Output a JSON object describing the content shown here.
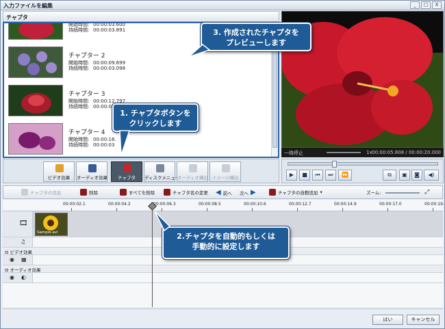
{
  "window": {
    "title": "入力ファイルを編集",
    "buttons": [
      "_",
      "□",
      "X"
    ]
  },
  "chapters_panel": {
    "header": "チャプタ",
    "items": [
      {
        "name": "",
        "start_label": "開始時間:",
        "start": "00:00:03.600",
        "length_label": "持続時間:",
        "length": "00:00:03.891"
      },
      {
        "name": "チャプター 2",
        "start_label": "開始時間:",
        "start": "00:00:09.699",
        "length_label": "持続時間:",
        "length": "00:00:03.098"
      },
      {
        "name": "チャプター 3",
        "start_label": "開始時間:",
        "start": "00:00:12.797",
        "length_label": "持続時間:",
        "length": "00:00:03"
      },
      {
        "name": "チャプター 4",
        "start_label": "開始時間:",
        "start": "00:00:16.",
        "length_label": "持続時間:",
        "length": "00:00:03"
      }
    ]
  },
  "preview": {
    "status": "一時停止",
    "speed": "1x",
    "time": "00:00:05.808 / 00:00:20.000"
  },
  "toolbar1": {
    "video_effects": "ビデオ効果",
    "audio_effects": "オーディオ効果",
    "chapters": "チャプタ",
    "disc_menu": "ディスクメニュー",
    "audio_out": "オーディオ構出",
    "image_out": "イメージ構出"
  },
  "toolbar2": {
    "add_chapter": "チャプタの追加",
    "delete": "削除",
    "delete_all": "すべてを削除",
    "rename": "チャプタ名の変更",
    "prev": "前へ",
    "next": "次へ",
    "auto_add": "チャプタの自動追加",
    "zoom": "ズーム:"
  },
  "ruler": [
    "00:00:02.1",
    "00:00:04.2",
    "00:00:06.3",
    "00:00:08.5",
    "00:00:10.6",
    "00:00:12.7",
    "00:00:14.9",
    "00:00:17.0",
    "00:00:19.1"
  ],
  "timeline": {
    "clip_name": "Sample.avi",
    "video_effects_section": "ビデオ効果",
    "audio_effects_section": "オーディオ効果"
  },
  "footer": {
    "ok": "はい",
    "cancel": "キャンセル"
  },
  "callouts": {
    "c1": "1. チャプタボタンを\nクリックします",
    "c2": "2.チャプタを自動的もしくは\n手動的に設定します",
    "c3": "3. 作成されたチャプタを\nプレビューします"
  }
}
